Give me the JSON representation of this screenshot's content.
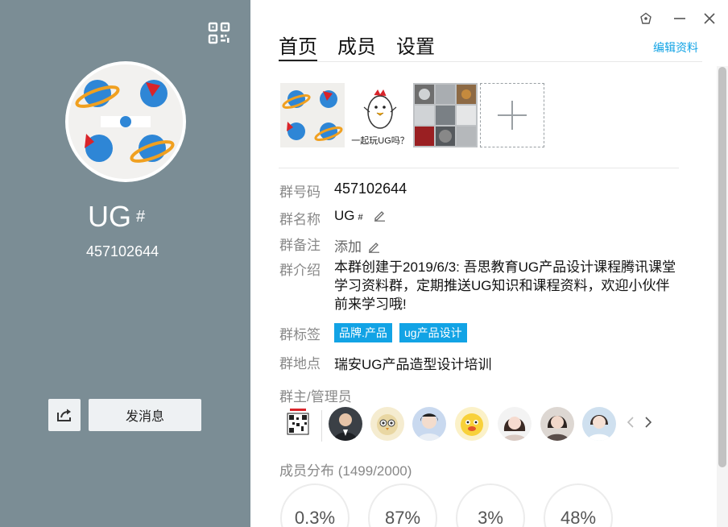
{
  "profile": {
    "name": "UG",
    "name_badge": "#",
    "number": "457102644",
    "send_message_label": "发消息"
  },
  "tabs": [
    {
      "label": "首页",
      "active": true
    },
    {
      "label": "成员",
      "active": false
    },
    {
      "label": "设置",
      "active": false
    }
  ],
  "edit_profile_label": "编辑资料",
  "photos": {
    "caption_2": "一起玩UG吗？"
  },
  "info": {
    "group_id_label": "群号码",
    "group_id_value": "457102644",
    "group_name_label": "群名称",
    "group_name_value": "UG",
    "group_name_badge": "#",
    "remark_label": "群备注",
    "remark_value": "添加",
    "intro_label": "群介绍",
    "intro_value": "本群创建于2019/6/3:  吾思教育UG产品设计课程腾讯课堂学习资料群，定期推送UG知识和课程资料，欢迎小伙伴前来学习哦!",
    "tags_label": "群标签",
    "tags": [
      "品牌.产品",
      "ug产品设计"
    ],
    "location_label": "群地点",
    "location_value": "瑞安UG产品造型设计培训"
  },
  "admins_label": "群主/管理员",
  "distribution": {
    "title": "成员分布",
    "count": "(1499/2000)",
    "stats": [
      "0.3%",
      "87%",
      "3%",
      "48%"
    ]
  },
  "colors": {
    "left_panel": "#7b8d95",
    "accent": "#12a3e5",
    "button_bg": "#eef1f3"
  }
}
